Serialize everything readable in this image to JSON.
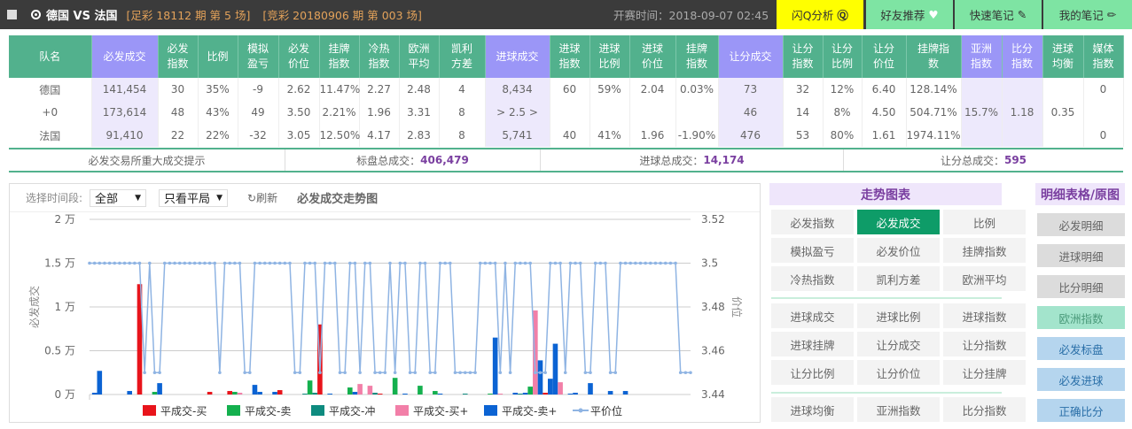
{
  "header": {
    "match": "德国  VS 法国",
    "lottery1": "[足彩 18112 期 第 5 场]",
    "lottery2": "[竞彩 20180906 期 第 003 场]",
    "start_time": "开赛时间：2018-09-07 02:45",
    "buttons": [
      {
        "label": "闪Q分析",
        "icon": "q-analysis-icon"
      },
      {
        "label": "好友推荐",
        "icon": "heart-icon"
      },
      {
        "label": "快速笔记",
        "icon": "edit-icon"
      },
      {
        "label": "我的笔记",
        "icon": "pencil-icon"
      }
    ]
  },
  "table": {
    "headers": [
      "队名",
      "必发成交",
      "必发\n指数",
      "比例",
      "模拟\n盈亏",
      "必发\n价位",
      "挂牌\n指数",
      "冷热\n指数",
      "欧洲\n平均",
      "凯利\n方差",
      "进球成交",
      "进球\n指数",
      "进球\n比例",
      "进球\n价位",
      "挂牌\n指数",
      "让分成交",
      "让分\n指数",
      "让分\n比例",
      "让分\n价位",
      "挂牌指\n数",
      "亚洲\n指数",
      "比分\n指数",
      "进球\n均衡",
      "媒体\n指数"
    ],
    "rows": [
      [
        "德国",
        "141,454",
        "30",
        "35%",
        "-9",
        "2.62",
        "11.47%",
        "2.27",
        "2.48",
        "4",
        "8,434",
        "60",
        "59%",
        "2.04",
        "0.03%",
        "73",
        "32",
        "12%",
        "6.40",
        "128.14%",
        "0"
      ],
      [
        "+0",
        "173,614",
        "48",
        "43%",
        "49",
        "3.50",
        "2.21%",
        "1.96",
        "3.31",
        "8",
        "> 2.5 >",
        "",
        "",
        "",
        "",
        "46",
        "14",
        "8%",
        "4.50",
        "504.71%",
        ""
      ],
      [
        "法国",
        "91,410",
        "22",
        "22%",
        "-32",
        "3.05",
        "12.50%",
        "4.17",
        "2.83",
        "8",
        "5,741",
        "40",
        "41%",
        "1.96",
        "-1.90%",
        "476",
        "53",
        "80%",
        "1.61",
        "1974.11%",
        "0"
      ]
    ],
    "merged": {
      "asia": "15.7%",
      "score": "1.18",
      "goal_balance": "0.35"
    }
  },
  "summary": {
    "label": "必发交易所重大成交提示",
    "standard": "标盘总成交：",
    "standard_val": "406,479",
    "goal": "进球总成交：",
    "goal_val": "14,174",
    "handicap": "让分总成交：",
    "handicap_val": "595"
  },
  "toolbar": {
    "period_label": "选择时间段:",
    "period_value": "全部",
    "filter_value": "只看平局",
    "refresh": "刷新",
    "title": "必发成交走势图"
  },
  "chart_data": {
    "type": "bar",
    "title": "必发成交走势图",
    "ylabel": "必发成交",
    "y2label": "价位",
    "yticks": [
      "2 万",
      "1.5 万",
      "1 万",
      "0.5 万",
      "0 万"
    ],
    "ylim": [
      0,
      20000
    ],
    "y2ticks": [
      "3.52",
      "3.5",
      "3.48",
      "3.46",
      "3.44"
    ],
    "y2lim": [
      3.44,
      3.52
    ],
    "colors": {
      "buy": "#e8141b",
      "sell": "#14b04e",
      "rush": "#0e8b7f",
      "buyplus": "#f27fa8",
      "sellplus": "#0b63d3",
      "price": "#8fb4e3"
    },
    "series": [
      {
        "key": "buy",
        "name": "平成交-买"
      },
      {
        "key": "sell",
        "name": "平成交-卖"
      },
      {
        "key": "rush",
        "name": "平成交-冲"
      },
      {
        "key": "buyplus",
        "name": "平成交-买+"
      },
      {
        "key": "sellplus",
        "name": "平成交-卖+"
      },
      {
        "key": "price",
        "name": "平价位"
      }
    ],
    "points": 121,
    "price_runs": [
      [
        3.5,
        11
      ],
      [
        3.45,
        1
      ],
      [
        3.5,
        1
      ],
      [
        3.45,
        2
      ],
      [
        3.5,
        11
      ],
      [
        3.45,
        1
      ],
      [
        3.5,
        4
      ],
      [
        3.45,
        2
      ],
      [
        3.5,
        8
      ],
      [
        3.45,
        2
      ],
      [
        3.5,
        3
      ],
      [
        3.45,
        1
      ],
      [
        3.5,
        3
      ],
      [
        3.45,
        2
      ],
      [
        3.5,
        2
      ],
      [
        3.45,
        1
      ],
      [
        3.5,
        2
      ],
      [
        3.45,
        3
      ],
      [
        3.5,
        1
      ],
      [
        3.45,
        1
      ],
      [
        3.5,
        2
      ],
      [
        3.45,
        2
      ],
      [
        3.5,
        2
      ],
      [
        3.45,
        2
      ],
      [
        3.5,
        3
      ],
      [
        3.45,
        5
      ],
      [
        3.5,
        4
      ],
      [
        3.45,
        1
      ],
      [
        3.5,
        1
      ],
      [
        3.45,
        1
      ],
      [
        3.5,
        4
      ],
      [
        3.45,
        3
      ],
      [
        3.5,
        3
      ],
      [
        3.45,
        1
      ],
      [
        3.5,
        3
      ],
      [
        3.45,
        2
      ],
      [
        3.5,
        3
      ],
      [
        3.45,
        2
      ],
      [
        3.5,
        12
      ],
      [
        3.45,
        13
      ]
    ],
    "bars": [
      [
        1,
        "sellplus",
        200
      ],
      [
        2,
        "sellplus",
        2700
      ],
      [
        8,
        "sellplus",
        400
      ],
      [
        10,
        "buy",
        12600
      ],
      [
        13,
        "sell",
        300
      ],
      [
        14,
        "sellplus",
        1300
      ],
      [
        24,
        "buy",
        300
      ],
      [
        28,
        "buy",
        400
      ],
      [
        29,
        "sell",
        300
      ],
      [
        30,
        "buyplus",
        200
      ],
      [
        33,
        "sellplus",
        1100
      ],
      [
        34,
        "sellplus",
        300
      ],
      [
        37,
        "sellplus",
        300
      ],
      [
        38,
        "buy",
        500
      ],
      [
        43,
        "rush",
        100
      ],
      [
        44,
        "sell",
        1600
      ],
      [
        45,
        "rush",
        200
      ],
      [
        46,
        "buy",
        8000
      ],
      [
        48,
        "sellplus",
        100
      ],
      [
        52,
        "sell",
        800
      ],
      [
        53,
        "sellplus",
        300
      ],
      [
        54,
        "buyplus",
        1200
      ],
      [
        56,
        "buyplus",
        1000
      ],
      [
        57,
        "rush",
        200
      ],
      [
        58,
        "buy",
        100
      ],
      [
        61,
        "sell",
        1900
      ],
      [
        63,
        "sellplus",
        100
      ],
      [
        66,
        "sell",
        1000
      ],
      [
        69,
        "sell",
        400
      ],
      [
        70,
        "sellplus",
        100
      ],
      [
        75,
        "rush",
        100
      ],
      [
        80,
        "sell",
        100
      ],
      [
        81,
        "sellplus",
        6500
      ],
      [
        82,
        "buyplus",
        100
      ],
      [
        85,
        "sellplus",
        200
      ],
      [
        86,
        "rush",
        100
      ],
      [
        87,
        "sellplus",
        200
      ],
      [
        88,
        "sell",
        900
      ],
      [
        89,
        "buyplus",
        9600
      ],
      [
        90,
        "sellplus",
        3900
      ],
      [
        91,
        "buy",
        200
      ],
      [
        92,
        "sellplus",
        1800
      ],
      [
        93,
        "sellplus",
        5800
      ],
      [
        94,
        "buyplus",
        1400
      ],
      [
        96,
        "sellplus",
        100
      ],
      [
        97,
        "sellplus",
        200
      ],
      [
        100,
        "sellplus",
        1300
      ],
      [
        104,
        "sellplus",
        400
      ],
      [
        107,
        "sellplus",
        400
      ]
    ]
  },
  "right": {
    "trend_title": "走势图表",
    "trend_buttons": [
      "必发指数",
      "必发成交",
      "比例",
      "模拟盈亏",
      "必发价位",
      "挂牌指数",
      "冷热指数",
      "凯利方差",
      "欧洲平均",
      "进球成交",
      "进球比例",
      "进球指数",
      "进球挂牌",
      "让分成交",
      "让分指数",
      "让分比例",
      "让分价位",
      "让分挂牌",
      "进球均衡",
      "亚洲指数",
      "比分指数"
    ],
    "active": "必发成交",
    "detail_title": "明细表格/原图",
    "detail_buttons": [
      "必发明细",
      "进球明细",
      "比分明细",
      "欧洲指数",
      "必发标盘",
      "必发进球",
      "正确比分"
    ]
  }
}
